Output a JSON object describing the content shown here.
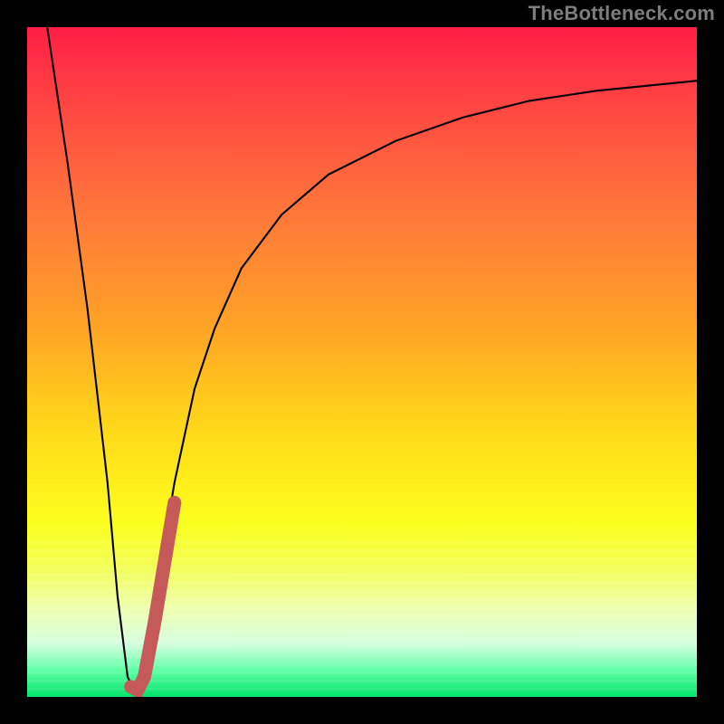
{
  "watermark": "TheBottleneck.com",
  "chart_data": {
    "type": "line",
    "title": "",
    "xlabel": "",
    "ylabel": "",
    "xlim": [
      0,
      100
    ],
    "ylim": [
      0,
      100
    ],
    "series": [
      {
        "name": "bottleneck-curve",
        "stroke": "#000000",
        "stroke_width": 2.1,
        "x": [
          3,
          6,
          9,
          12,
          13.5,
          15,
          16,
          17,
          18,
          20,
          22,
          25,
          28,
          32,
          38,
          45,
          55,
          65,
          75,
          85,
          95,
          100
        ],
        "y": [
          100,
          80,
          58,
          32,
          15,
          3,
          0.8,
          2,
          8,
          20,
          32,
          46,
          55,
          64,
          72,
          78,
          83,
          86.5,
          89,
          90.5,
          91.5,
          92
        ]
      },
      {
        "name": "highlight-segment",
        "stroke": "#c65a5a",
        "stroke_width": 15,
        "linecap": "round",
        "x": [
          15.5,
          16.5,
          17.5,
          19,
          20.5,
          22
        ],
        "y": [
          1.5,
          1.0,
          3,
          11,
          20,
          29
        ]
      }
    ],
    "background_gradient": {
      "stops": [
        "#ff1e46",
        "#ff7d38",
        "#ffe91a",
        "#00e56a"
      ],
      "direction": "vertical"
    }
  }
}
